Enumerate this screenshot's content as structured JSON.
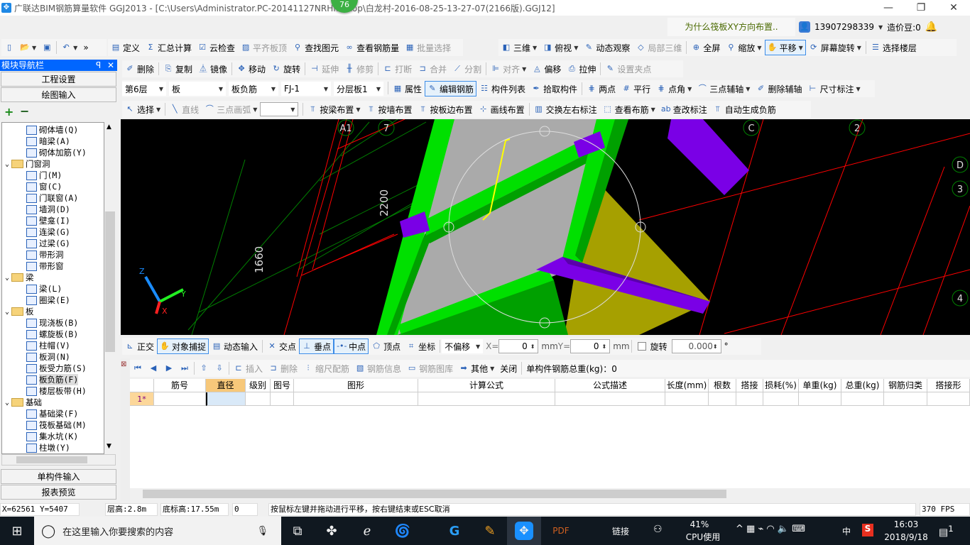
{
  "window": {
    "title": "广联达BIM钢筋算量软件 GGJ2013 - [C:\\Users\\Administrator.PC-20141127NRHI...ktop\\白龙村-2016-08-25-13-27-07(2166版).GGJ12]",
    "badge": "76",
    "minimize": "—",
    "restore": "❐",
    "close": "✕"
  },
  "info": {
    "question": "为什么筏板XY方向布置..",
    "user": "13907298339",
    "beans": "造价豆:0"
  },
  "toolbar1": [
    {
      "label": "",
      "icon": "new-file-icon",
      "g": "▯"
    },
    {
      "label": "",
      "icon": "open-folder-icon",
      "g": "📂",
      "dd": 1
    },
    {
      "label": "",
      "icon": "save-icon",
      "g": "▣"
    },
    {
      "sep": 1
    },
    {
      "label": "",
      "icon": "undo-icon",
      "g": "↶",
      "dd": 1
    },
    {
      "label": "»",
      "icon": "more-icon",
      "g": ""
    },
    {
      "label": "定义",
      "icon": "define-icon",
      "g": "▤"
    },
    {
      "label": "汇总计算",
      "icon": "sigma-icon",
      "g": "Σ"
    },
    {
      "label": "云检查",
      "icon": "cloud-check-icon",
      "g": "☑"
    },
    {
      "label": "平齐板顶",
      "icon": "align-top-icon",
      "g": "▨",
      "dis": 1
    },
    {
      "label": "查找图元",
      "icon": "binoculars-icon",
      "g": "⚲"
    },
    {
      "label": "查看钢筋量",
      "icon": "glasses-icon",
      "g": "∞"
    },
    {
      "label": "批量选择",
      "icon": "batch-select-icon",
      "g": "▦",
      "dis": 1
    }
  ],
  "toolbar1r": [
    {
      "label": "三维",
      "icon": "cube-icon",
      "g": "◧",
      "dd": 1
    },
    {
      "label": "俯视",
      "icon": "top-view-icon",
      "g": "◨",
      "dd": 1
    },
    {
      "label": "动态观察",
      "icon": "orbit-icon",
      "g": "✎"
    },
    {
      "label": "局部三维",
      "icon": "local-3d-icon",
      "g": "◇",
      "dis": 1
    },
    {
      "sep": 1
    },
    {
      "label": "全屏",
      "icon": "fullscreen-icon",
      "g": "⊕"
    },
    {
      "label": "缩放",
      "icon": "zoom-icon",
      "g": "⚲",
      "dd": 1
    },
    {
      "label": "平移",
      "icon": "pan-hand-icon",
      "g": "✋",
      "act": 1,
      "dd": 1
    },
    {
      "label": "屏幕旋转",
      "icon": "screen-rotate-icon",
      "g": "⟳",
      "dd": 1
    },
    {
      "sep": 1
    },
    {
      "label": "选择楼层",
      "icon": "select-floor-icon",
      "g": "☰"
    }
  ],
  "toolbar2": [
    {
      "label": "删除",
      "icon": "eraser-icon",
      "g": "✐"
    },
    {
      "sep": 1
    },
    {
      "label": "复制",
      "icon": "copy-icon",
      "g": "⎘"
    },
    {
      "label": "镜像",
      "icon": "mirror-icon",
      "g": "⏅"
    },
    {
      "sep": 1
    },
    {
      "label": "移动",
      "icon": "move-icon",
      "g": "✥"
    },
    {
      "label": "旋转",
      "icon": "rotate-icon",
      "g": "↻"
    },
    {
      "sep": 1
    },
    {
      "label": "延伸",
      "icon": "extend-icon",
      "g": "⊣",
      "dis": 1
    },
    {
      "label": "修剪",
      "icon": "trim-icon",
      "g": "╫",
      "dis": 1
    },
    {
      "sep": 1
    },
    {
      "label": "打断",
      "icon": "break-icon",
      "g": "⊏",
      "dis": 1
    },
    {
      "label": "合并",
      "icon": "merge-icon",
      "g": "⊐",
      "dis": 1
    },
    {
      "label": "分割",
      "icon": "split-icon",
      "g": "⟋",
      "dis": 1
    },
    {
      "sep": 1
    },
    {
      "label": "对齐",
      "icon": "align-icon",
      "g": "⊫",
      "dis": 1,
      "dd": 1
    },
    {
      "label": "偏移",
      "icon": "offset-icon",
      "g": "◬"
    },
    {
      "label": "拉伸",
      "icon": "stretch-icon",
      "g": "⎙"
    },
    {
      "sep": 1
    },
    {
      "label": "设置夹点",
      "icon": "grip-icon",
      "g": "✎",
      "dis": 1
    }
  ],
  "selectors": [
    {
      "value": "第6层",
      "w": 62
    },
    {
      "value": "板",
      "w": 80
    },
    {
      "value": "板负筋",
      "w": 70
    },
    {
      "value": "FJ-1",
      "w": 70
    },
    {
      "value": "分层板1",
      "w": 70
    }
  ],
  "toolbar3": [
    {
      "label": "属性",
      "icon": "properties-icon",
      "g": "▦"
    },
    {
      "label": "编辑钢筋",
      "icon": "edit-rebar-icon",
      "g": "✎",
      "act": 1
    },
    {
      "label": "构件列表",
      "icon": "component-list-icon",
      "g": "☷"
    },
    {
      "label": "拾取构件",
      "icon": "pick-icon",
      "g": "✒"
    },
    {
      "sep": 1
    },
    {
      "label": "两点",
      "icon": "two-point-axis-icon",
      "g": "⋕"
    },
    {
      "label": "平行",
      "icon": "parallel-axis-icon",
      "g": "#"
    },
    {
      "label": "点角",
      "icon": "point-angle-icon",
      "g": "⋕",
      "dd": 1
    },
    {
      "label": "三点辅轴",
      "icon": "three-point-axis-icon",
      "g": "⌒",
      "dd": 1
    },
    {
      "label": "删除辅轴",
      "icon": "delete-axis-icon",
      "g": "✐"
    },
    {
      "label": "尺寸标注",
      "icon": "dimension-icon",
      "g": "⊢",
      "dd": 1
    }
  ],
  "toolbar4": [
    {
      "label": "选择",
      "icon": "cursor-icon",
      "g": "↖",
      "dd": 1
    },
    {
      "sep": 1
    },
    {
      "label": "直线",
      "icon": "line-icon",
      "g": "╲",
      "dis": 1
    },
    {
      "label": "三点画弧",
      "icon": "arc-icon",
      "g": "⌒",
      "dis": 1,
      "dd": 1
    },
    {
      "combo": 1
    },
    {
      "sep": 1
    },
    {
      "label": "按梁布置",
      "icon": "by-beam-icon",
      "g": "⫪",
      "dd": 1
    },
    {
      "label": "按墙布置",
      "icon": "by-wall-icon",
      "g": "⫪"
    },
    {
      "label": "按板边布置",
      "icon": "by-slab-edge-icon",
      "g": "⫪"
    },
    {
      "label": "画线布置",
      "icon": "draw-line-icon",
      "g": "⊹"
    },
    {
      "sep": 1
    },
    {
      "label": "交换左右标注",
      "icon": "swap-label-icon",
      "g": "▥"
    },
    {
      "label": "查看布筋",
      "icon": "view-rebar-icon",
      "g": "⬚",
      "dd": 1
    },
    {
      "label": "查改标注",
      "icon": "abc-icon",
      "g": "ab"
    },
    {
      "label": "自动生成负筋",
      "icon": "auto-rebar-icon",
      "g": "⫪"
    }
  ],
  "sidebar": {
    "title": "模块导航栏",
    "pin": "ꟼ",
    "close": "✕",
    "project_settings": "工程设置",
    "drawing_input": "绘图输入",
    "expand": "+",
    "collapse": "−",
    "single_input": "单构件输入",
    "report_preview": "报表预览",
    "tree": [
      {
        "label": "砌体墙(Q)",
        "lv": 2
      },
      {
        "label": "暗梁(A)",
        "lv": 2
      },
      {
        "label": "砌体加筋(Y)",
        "lv": 2
      },
      {
        "label": "门窗洞",
        "lv": 1
      },
      {
        "label": "门(M)",
        "lv": 2
      },
      {
        "label": "窗(C)",
        "lv": 2
      },
      {
        "label": "门联窗(A)",
        "lv": 2
      },
      {
        "label": "墙洞(D)",
        "lv": 2
      },
      {
        "label": "壁龛(I)",
        "lv": 2
      },
      {
        "label": "连梁(G)",
        "lv": 2
      },
      {
        "label": "过梁(G)",
        "lv": 2
      },
      {
        "label": "带形洞",
        "lv": 2
      },
      {
        "label": "带形窗",
        "lv": 2
      },
      {
        "label": "梁",
        "lv": 1
      },
      {
        "label": "梁(L)",
        "lv": 2
      },
      {
        "label": "圈梁(E)",
        "lv": 2
      },
      {
        "label": "板",
        "lv": 1
      },
      {
        "label": "现浇板(B)",
        "lv": 2
      },
      {
        "label": "螺旋板(B)",
        "lv": 2
      },
      {
        "label": "柱帽(V)",
        "lv": 2
      },
      {
        "label": "板洞(N)",
        "lv": 2
      },
      {
        "label": "板受力筋(S)",
        "lv": 2
      },
      {
        "label": "板负筋(F)",
        "lv": 2,
        "sel": 1
      },
      {
        "label": "楼层板带(H)",
        "lv": 2
      },
      {
        "label": "基础",
        "lv": 1
      },
      {
        "label": "基础梁(F)",
        "lv": 2
      },
      {
        "label": "筏板基础(M)",
        "lv": 2
      },
      {
        "label": "集水坑(K)",
        "lv": 2
      },
      {
        "label": "柱墩(Y)",
        "lv": 2
      }
    ]
  },
  "viewport": {
    "axis_labels": [
      "A1",
      "7",
      "C",
      "2",
      "D",
      "3",
      "4"
    ],
    "dims": [
      "2200",
      "1660"
    ],
    "triad": {
      "z": "Z",
      "y": "Y",
      "x": "X"
    },
    "colors": {
      "beam": "#00e000",
      "beam_dark": "#00a000",
      "slab": "#aaaaaa",
      "column": "#7a00e6",
      "slab2": "#a6a000",
      "grid_red": "#ff0000",
      "grid_green": "#008000",
      "rebar": "#ffff00"
    }
  },
  "snapbar": {
    "items": [
      {
        "label": "正交",
        "icon": "ortho-icon",
        "g": "⊾"
      },
      {
        "label": "对象捕捉",
        "icon": "object-snap-icon",
        "g": "✋",
        "act": 1
      },
      {
        "label": "动态输入",
        "icon": "dynamic-input-icon",
        "g": "▤"
      },
      {
        "sep": 1
      },
      {
        "label": "交点",
        "icon": "intersection-icon",
        "g": "✕"
      },
      {
        "label": "垂点",
        "icon": "perpendicular-icon",
        "g": "⊥",
        "act": 1
      },
      {
        "label": "中点",
        "icon": "midpoint-icon",
        "g": "-•-",
        "act": 1
      },
      {
        "label": "顶点",
        "icon": "vertex-icon",
        "g": "⬠"
      },
      {
        "label": "坐标",
        "icon": "coordinate-icon",
        "g": "⌗"
      }
    ],
    "offset_mode": "不偏移",
    "x_label": "X=",
    "x_value": "0",
    "y_label": "Y=",
    "y_value": "0",
    "unit": "mm",
    "rotate_label": "旋转",
    "rotate_value": "0.000",
    "degree": "°"
  },
  "gridtoolbar": {
    "items": [
      {
        "label": "",
        "icon": "first-icon",
        "g": "⏮",
        "dis": 1
      },
      {
        "label": "",
        "icon": "prev-icon",
        "g": "◀",
        "dis": 1
      },
      {
        "label": "",
        "icon": "next-icon",
        "g": "▶",
        "dis": 1
      },
      {
        "label": "",
        "icon": "last-icon",
        "g": "⏭",
        "dis": 1
      },
      {
        "sep": 1
      },
      {
        "label": "",
        "icon": "move-up-icon",
        "g": "⇧",
        "dis": 1
      },
      {
        "label": "",
        "icon": "move-down-icon",
        "g": "⇩",
        "dis": 1
      },
      {
        "sep": 1
      },
      {
        "label": "插入",
        "icon": "insert-row-icon",
        "g": "⊏",
        "dis": 1
      },
      {
        "label": "删除",
        "icon": "delete-row-icon",
        "g": "⊐",
        "dis": 1
      },
      {
        "label": "缩尺配筋",
        "icon": "scale-rebar-icon",
        "g": "⫶",
        "dis": 1
      },
      {
        "label": "钢筋信息",
        "icon": "rebar-info-icon",
        "g": "▧",
        "dis": 1
      },
      {
        "label": "钢筋图库",
        "icon": "rebar-library-icon",
        "g": "▭",
        "dis": 1
      },
      {
        "label": "其他",
        "icon": "other-icon",
        "g": "➡",
        "dd": 1
      },
      {
        "label": "关闭",
        "icon": "",
        "g": ""
      },
      {
        "sep": 1
      }
    ],
    "total_label": "单构件钢筋总重(kg)：0"
  },
  "table": {
    "columns": [
      "筋号",
      "直径(mm)",
      "级别",
      "图号",
      "图形",
      "计算公式",
      "公式描述",
      "长度(mm)",
      "根数",
      "搭接",
      "损耗(%)",
      "单重(kg)",
      "总重(kg)",
      "钢筋归类",
      "搭接形"
    ],
    "rows": [
      {
        "index": "1*",
        "cells": [
          "",
          "",
          "",
          "",
          "",
          "",
          "",
          "",
          "",
          "",
          "",
          "",
          "",
          "",
          ""
        ]
      }
    ],
    "active_column": "直径(mm)"
  },
  "statusbar": {
    "coords": "X=62561 Y=5407",
    "floor_height": "层高:2.8m",
    "base_height": "底标高:17.55m",
    "value": "0",
    "hint": "按鼠标左键并拖动进行平移，按右键结束或ESC取消",
    "fps": "370 FPS"
  },
  "taskbar": {
    "search_placeholder": "在这里输入你要搜索的内容",
    "link": "链接",
    "cpu_percent": "41%",
    "cpu_label": "CPU使用",
    "ime": "中",
    "time": "16:03",
    "date": "2018/9/18",
    "notifications": "1"
  }
}
